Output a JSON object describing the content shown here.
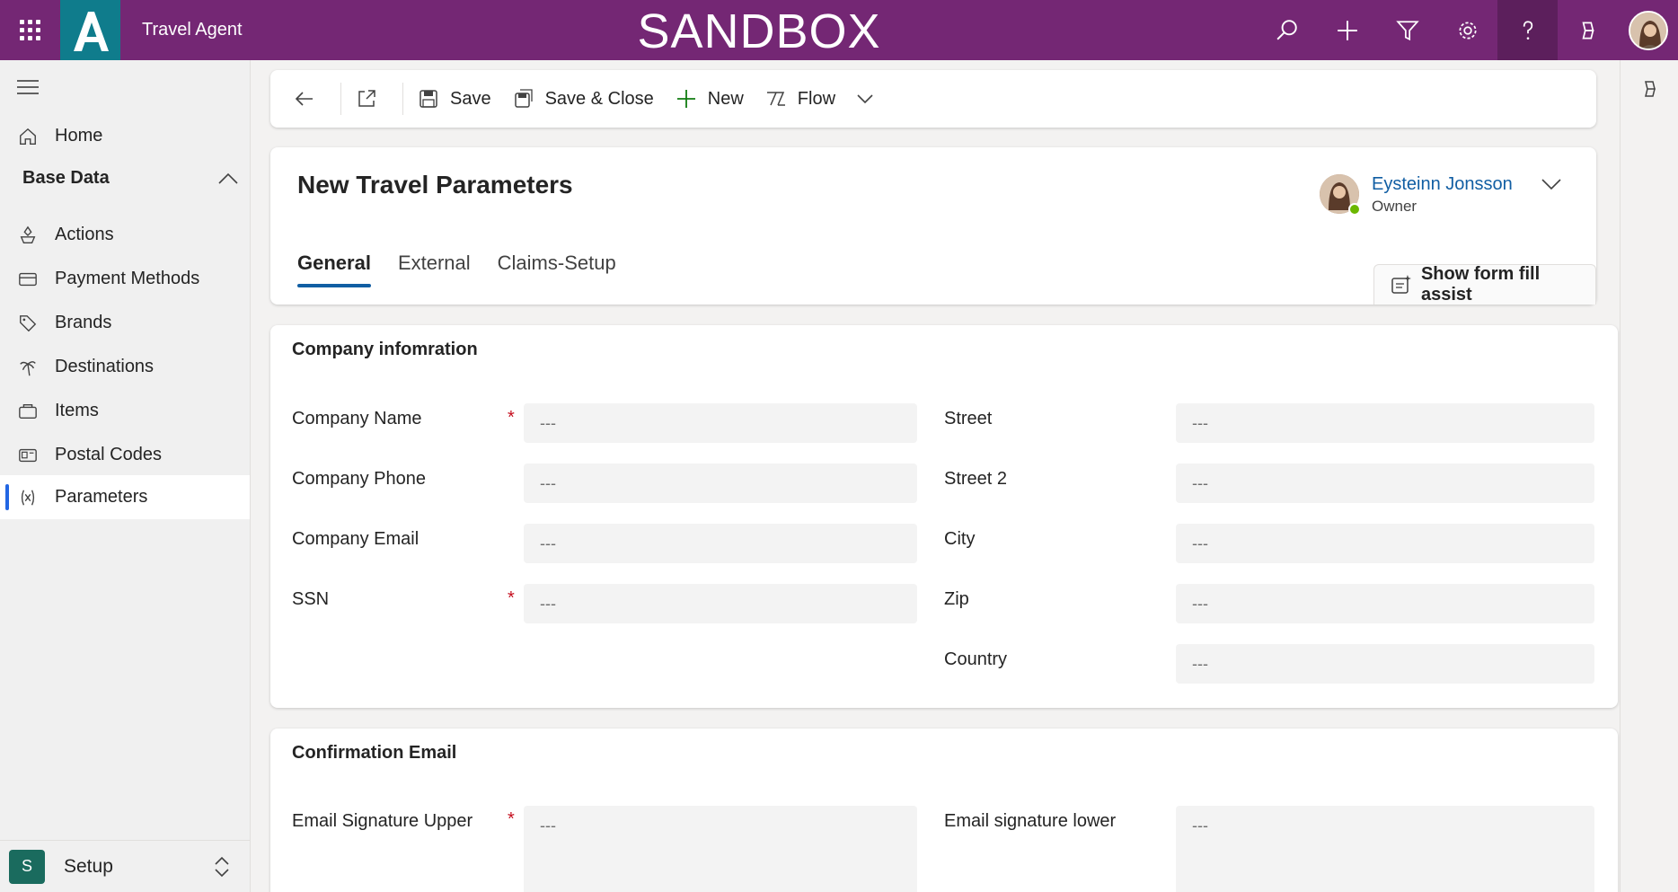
{
  "topbar": {
    "app_name": "Travel Agent",
    "environment": "SANDBOX",
    "icons": [
      "search-icon",
      "add-icon",
      "filter-icon",
      "settings-icon",
      "help-icon",
      "copilot-icon"
    ]
  },
  "sidebar": {
    "group_label": "Base Data",
    "home_label": "Home",
    "items": [
      {
        "label": "Actions",
        "icon": "actions-icon"
      },
      {
        "label": "Payment Methods",
        "icon": "card-icon"
      },
      {
        "label": "Brands",
        "icon": "tag-icon"
      },
      {
        "label": "Destinations",
        "icon": "palm-icon"
      },
      {
        "label": "Items",
        "icon": "box-icon"
      },
      {
        "label": "Postal Codes",
        "icon": "postal-icon"
      },
      {
        "label": "Parameters",
        "icon": "variable-icon",
        "selected": true
      }
    ],
    "area": {
      "badge": "S",
      "label": "Setup"
    }
  },
  "commandbar": {
    "save_label": "Save",
    "save_close_label": "Save & Close",
    "new_label": "New",
    "flow_label": "Flow"
  },
  "header": {
    "title": "New Travel Parameters",
    "owner_name": "Eysteinn Jonsson",
    "owner_role": "Owner",
    "tabs": [
      "General",
      "External",
      "Claims-Setup"
    ],
    "assist_label": "Show form fill assist"
  },
  "sections": {
    "company": {
      "title": "Company infomration",
      "left_fields": [
        {
          "label": "Company Name",
          "value": "---",
          "required": true
        },
        {
          "label": "Company Phone",
          "value": "---",
          "required": false
        },
        {
          "label": "Company Email",
          "value": "---",
          "required": false
        },
        {
          "label": "SSN",
          "value": "---",
          "required": true
        }
      ],
      "right_fields": [
        {
          "label": "Street",
          "value": "---"
        },
        {
          "label": "Street 2",
          "value": "---"
        },
        {
          "label": "City",
          "value": "---"
        },
        {
          "label": "Zip",
          "value": "---"
        },
        {
          "label": "Country",
          "value": "---"
        }
      ]
    },
    "confirmation": {
      "title": "Confirmation Email",
      "upper_label": "Email Signature Upper",
      "upper_value": "---",
      "lower_label": "Email signature lower",
      "lower_value": "---",
      "required_mark": "*"
    }
  },
  "colors": {
    "topbar": "#742774",
    "accent": "#115ea3",
    "required": "#c50f1f"
  }
}
